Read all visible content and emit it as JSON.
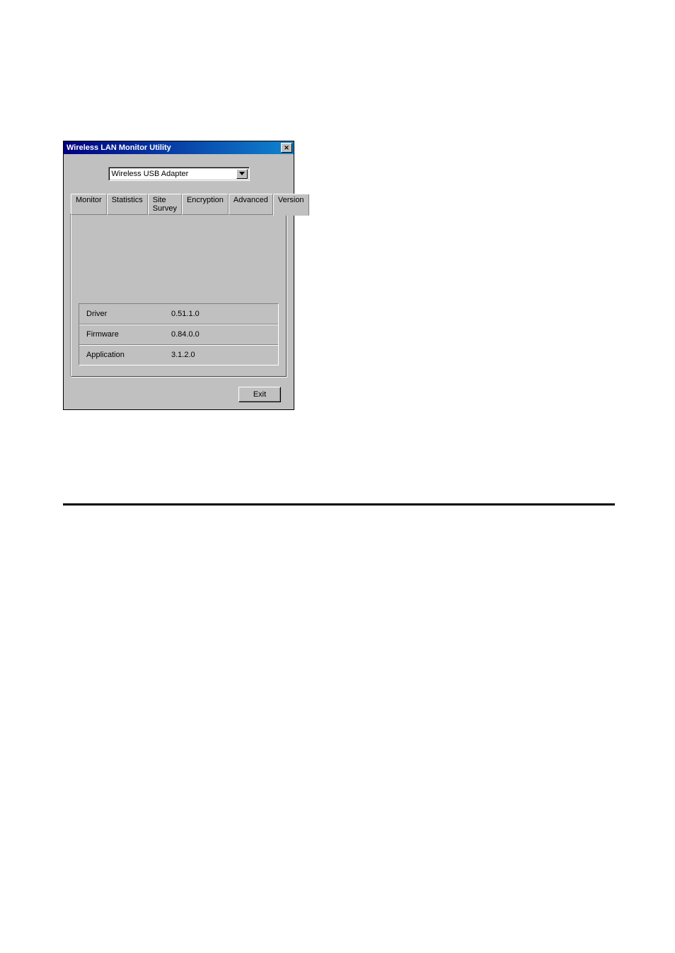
{
  "window": {
    "title": "Wireless LAN Monitor Utility"
  },
  "adapter": {
    "selected": "Wireless USB Adapter"
  },
  "tabs": {
    "monitor": "Monitor",
    "statistics": "Statistics",
    "site_survey": "Site Survey",
    "encryption": "Encryption",
    "advanced": "Advanced",
    "version": "Version"
  },
  "version_info": [
    {
      "label": "Driver",
      "value": "0.51.1.0"
    },
    {
      "label": "Firmware",
      "value": "0.84.0.0"
    },
    {
      "label": "Application",
      "value": "3.1.2.0"
    }
  ],
  "buttons": {
    "exit": "Exit"
  }
}
